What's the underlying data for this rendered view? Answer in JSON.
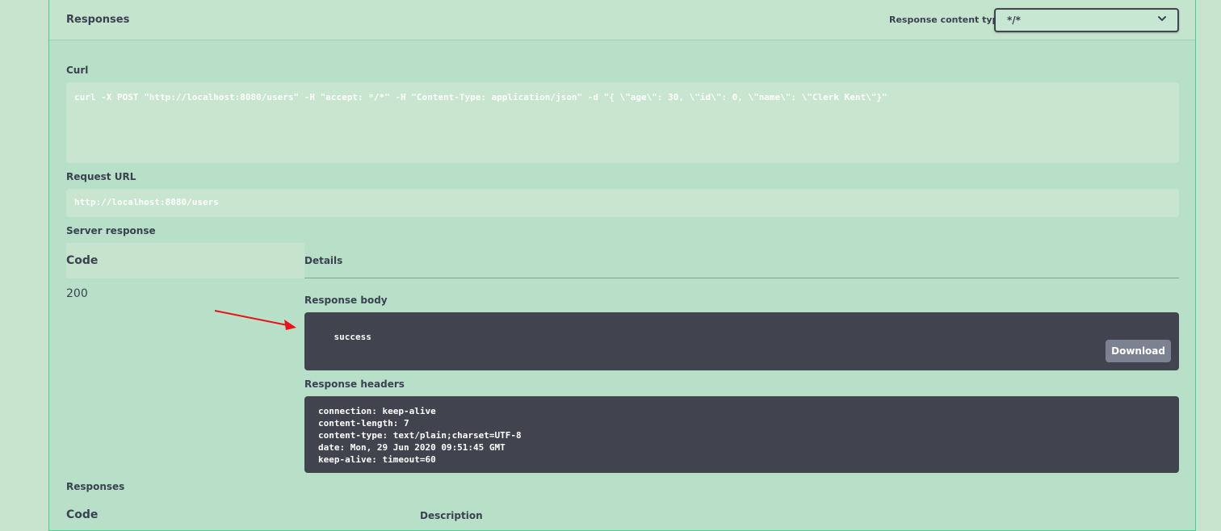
{
  "responses_header": {
    "title": "Responses",
    "content_type_label": "Response content type",
    "content_type_value": "*/*"
  },
  "curl": {
    "label": "Curl",
    "command": "curl -X POST \"http://localhost:8080/users\" -H \"accept: */*\" -H \"Content-Type: application/json\" -d \"{ \\\"age\\\": 30, \\\"id\\\": 0, \\\"name\\\": \\\"Clerk Kent\\\"}\""
  },
  "request_url": {
    "label": "Request URL",
    "value": "http://localhost:8080/users"
  },
  "server_response": {
    "label": "Server response",
    "code_header": "Code",
    "details_header": "Details",
    "code": "200",
    "body_label": "Response body",
    "body": "success",
    "download_label": "Download",
    "headers_label": "Response headers",
    "headers": [
      "connection: keep-alive",
      "content-length: 7",
      "content-type: text/plain;charset=UTF-8",
      "date: Mon, 29 Jun 2020 09:51:45 GMT",
      "keep-alive: timeout=60"
    ]
  },
  "responses_section": {
    "label": "Responses",
    "code_header": "Code",
    "description_header": "Description"
  },
  "colors": {
    "accent": "#49cc90",
    "dark_box": "#41444e",
    "arrow": "#e8141c"
  }
}
